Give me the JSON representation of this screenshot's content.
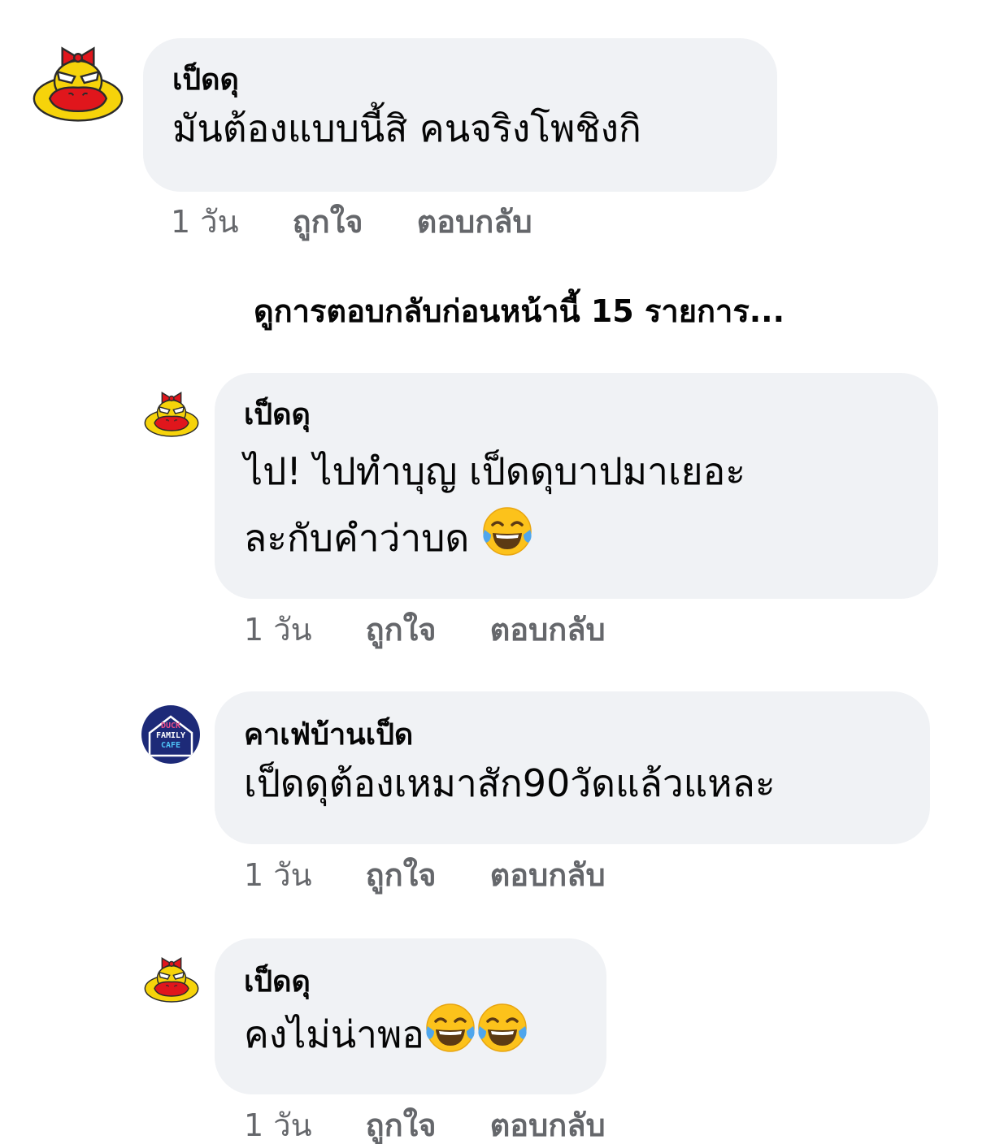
{
  "colors": {
    "bubble_bg": "#f0f2f5",
    "text_primary": "#050505",
    "text_secondary": "#65676b"
  },
  "comments": [
    {
      "author": "เป็ดดุ",
      "text_lines": [
        "มันต้องแบบนี้สิ คนจริงโพชิงกิ"
      ],
      "avatar_icon": "angry-duck-bow-avatar",
      "time": "1 วัน",
      "like_label": "ถูกใจ",
      "reply_label": "ตอบกลับ"
    },
    {
      "author": "เป็ดดุ",
      "text_lines": [
        "ไป! ไปทำบุญ เป็ดดุบาปมาเยอะ",
        "ละกับคำว่าบด"
      ],
      "emojis": [
        "laughing-tears-emoji"
      ],
      "avatar_icon": "angry-duck-bow-avatar",
      "time": "1 วัน",
      "like_label": "ถูกใจ",
      "reply_label": "ตอบกลับ"
    },
    {
      "author": "คาเฟ่บ้านเป็ด",
      "text_lines": [
        "เป็ดดุต้องเหมาสัก90วัดแล้วแหละ"
      ],
      "avatar_icon": "duck-family-cafe-logo-avatar",
      "avatar_text": [
        "DUCK",
        "FAMILY",
        "CAFE"
      ],
      "time": "1 วัน",
      "like_label": "ถูกใจ",
      "reply_label": "ตอบกลับ"
    },
    {
      "author": "เป็ดดุ",
      "text_lines": [
        "คงไม่น่าพอ"
      ],
      "emojis": [
        "laughing-tears-emoji",
        "laughing-tears-emoji"
      ],
      "avatar_icon": "angry-duck-bow-avatar",
      "time": "1 วัน",
      "like_label": "ถูกใจ",
      "reply_label": "ตอบกลับ"
    }
  ],
  "view_previous_replies": "ดูการตอบกลับก่อนหน้านี้ 15 รายการ..."
}
